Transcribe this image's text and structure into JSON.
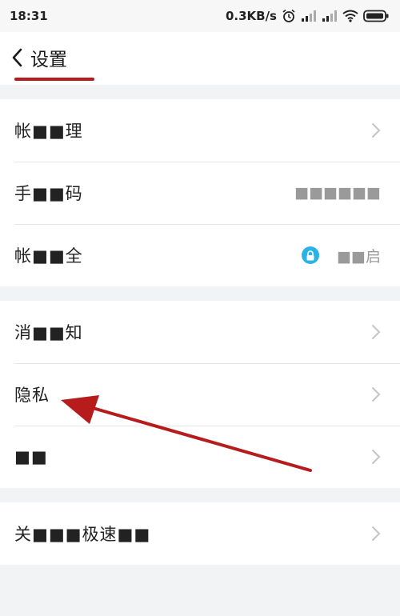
{
  "status_bar": {
    "time": "18:31",
    "net_speed": "0.3KB/s",
    "icons": [
      "alarm-icon",
      "signal-icon",
      "signal-icon",
      "wifi-icon",
      "battery-icon"
    ]
  },
  "header": {
    "back_icon": "chevron-left-icon",
    "title": "设置"
  },
  "groups": [
    {
      "rows": [
        {
          "label": "帐■■理",
          "value": ""
        },
        {
          "label": "手■■码",
          "value": "■■■■■■"
        },
        {
          "label": "帐■■全",
          "value": "■■启",
          "icon": "lock-icon"
        }
      ]
    },
    {
      "rows": [
        {
          "label": "消■■知",
          "value": ""
        },
        {
          "label": "隐私",
          "value": ""
        },
        {
          "label": "■■",
          "value": ""
        }
      ]
    },
    {
      "rows": [
        {
          "label": "关■■■极速■■",
          "value": ""
        }
      ]
    }
  ],
  "colors": {
    "accent_red": "#b71c1c",
    "lock_blue": "#2bb3e6",
    "background": "#f2f3f5"
  },
  "annotation": {
    "icon": "arrow-annotation"
  }
}
